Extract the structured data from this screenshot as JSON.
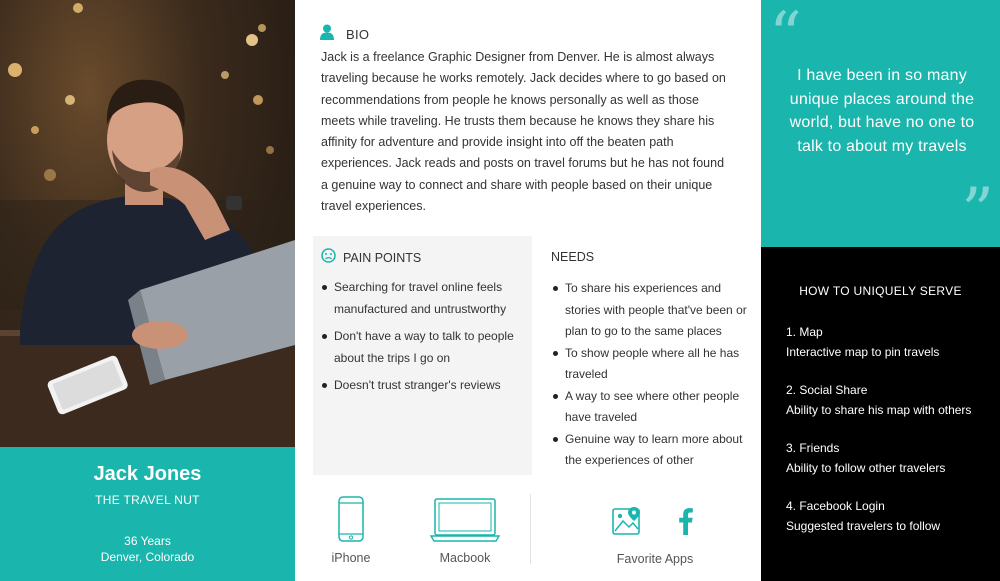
{
  "profile": {
    "name": "Jack Jones",
    "tagline": "THE TRAVEL NUT",
    "age": "36  Years",
    "location": "Denver, Colorado"
  },
  "bio": {
    "label": "BIO",
    "text": "Jack  is a freelance Graphic Designer from Denver. He is almost always traveling because he works remotely. Jack decides where to go based on recommendations from people he knows personally as well as those meets while traveling. He trusts them because he knows they share his affinity for adventure and provide insight into off the beaten path experiences. Jack reads and posts on travel forums but he has not found a genuine way to connect and share with people based on their unique travel experiences."
  },
  "pain_points": {
    "label": "PAIN POINTS",
    "items": [
      "Searching for travel online feels manufactured and untrustworthy",
      "Don't have a way to talk to people about the trips I go on",
      "Doesn't trust stranger's reviews"
    ]
  },
  "needs": {
    "label": "NEEDS",
    "items": [
      "To share his experiences and stories with people that've been or plan to go to the same places",
      "To show people where all he has traveled",
      "A way to see where other people have traveled",
      "Genuine way to learn more about the experiences of other"
    ]
  },
  "devices": {
    "iphone": "iPhone",
    "macbook": "Macbook",
    "apps_label": "Favorite Apps"
  },
  "quote": {
    "open_mark": "“",
    "close_mark": "”",
    "text": "I have been in so many unique places around the world, but have no one to talk to about my travels"
  },
  "serve": {
    "title": "HOW TO UNIQUELY SERVE",
    "items": [
      {
        "heading": "1. Map",
        "detail": "Interactive map to pin travels"
      },
      {
        "heading": "2. Social Share",
        "detail": "Ability to share his map with others"
      },
      {
        "heading": "3.  Friends",
        "detail": "Ability to follow other travelers"
      },
      {
        "heading": "4. Facebook Login",
        "detail": "Suggested travelers to follow"
      }
    ]
  },
  "colors": {
    "accent": "#1ab5ac",
    "dark_panel": "#000000",
    "pain_bg": "#f4f4f4"
  }
}
